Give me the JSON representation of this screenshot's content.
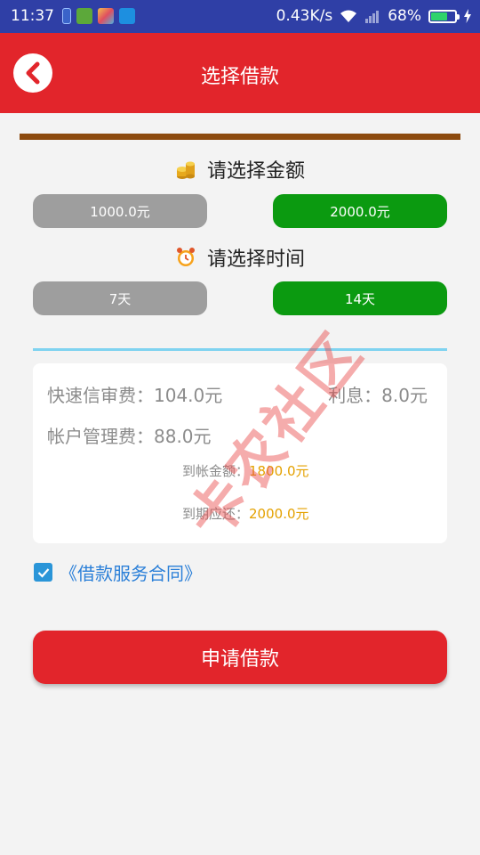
{
  "status_bar": {
    "time": "11:37",
    "speed": "0.43K/s",
    "battery_percent": "68%",
    "battery_level": 0.68
  },
  "header": {
    "title": "选择借款"
  },
  "amount_section": {
    "title": "请选择金额",
    "icon": "coins-icon",
    "options": [
      "1000.0元",
      "2000.0元"
    ],
    "selected": 1
  },
  "time_section": {
    "title": "请选择时间",
    "icon": "alarm-clock-icon",
    "options": [
      "7天",
      "14天"
    ],
    "selected": 1
  },
  "fees": {
    "credit_fee": "快速信审费：104.0元",
    "interest": "利息：8.0元",
    "account_fee": "帐户管理费：88.0元",
    "received_label": "到帐金额：",
    "received_value": "1800.0元",
    "due_label": "到期应还：",
    "due_value": "2000.0元"
  },
  "contract": {
    "checked": true,
    "label": "《借款服务合同》"
  },
  "apply_button": {
    "label": "申请借款"
  },
  "watermark": "卡农社区",
  "colors": {
    "status_bar": "#2f3fa6",
    "header": "#e2252b",
    "selected": "#0b9a10",
    "unselected": "#9e9e9e",
    "accent_value": "#e4a100",
    "link": "#2a7fd8"
  }
}
